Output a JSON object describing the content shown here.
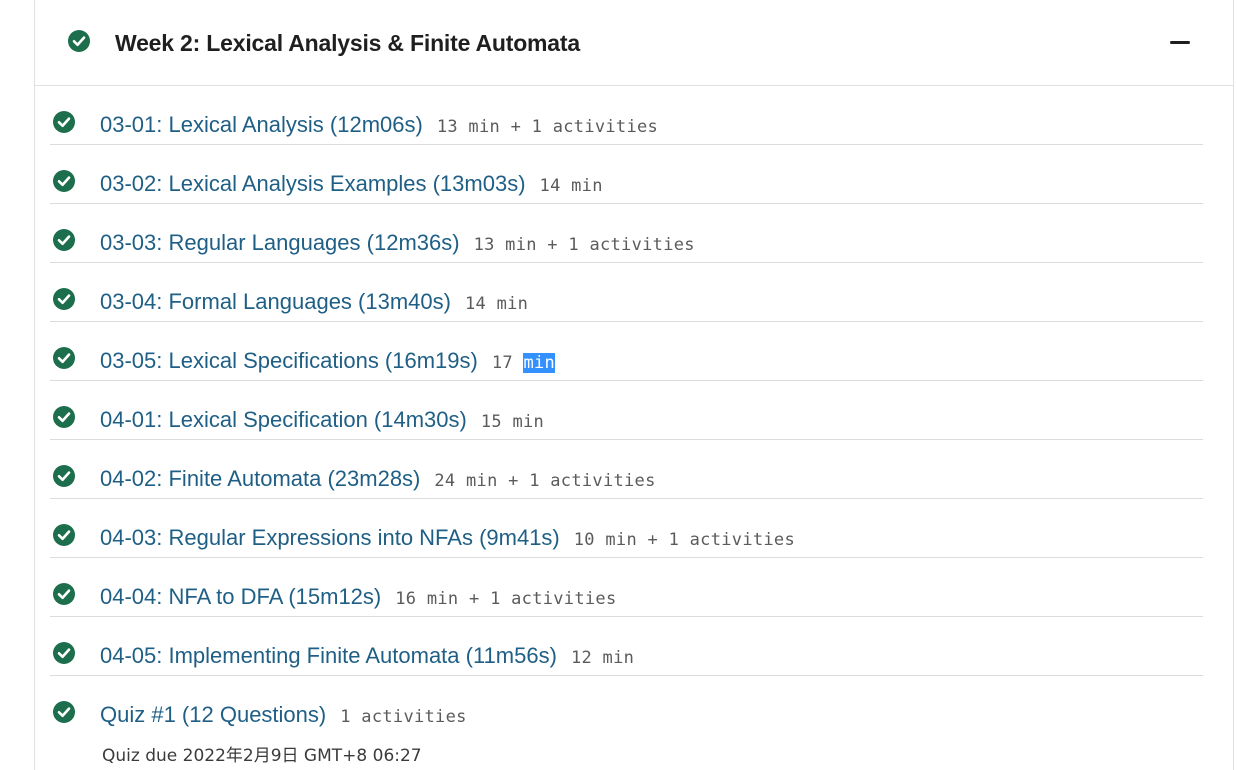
{
  "week": {
    "title": "Week 2: Lexical Analysis & Finite Automata",
    "status_icon": "check-circle-icon",
    "collapse_icon": "minus-icon"
  },
  "colors": {
    "check": "#1d6e4d",
    "link": "#1f5f86",
    "selection": "#3390ff"
  },
  "items": [
    {
      "title": "03-01: Lexical Analysis (12m06s)",
      "meta": "13 min + 1 activities"
    },
    {
      "title": "03-02: Lexical Analysis Examples (13m03s)",
      "meta": "14 min"
    },
    {
      "title": "03-03: Regular Languages (12m36s)",
      "meta": "13 min + 1 activities"
    },
    {
      "title": "03-04: Formal Languages (13m40s)",
      "meta": "14 min"
    },
    {
      "title": "03-05: Lexical Specifications (16m19s)",
      "meta_prefix": "17 ",
      "meta_selected": "min"
    },
    {
      "title": "04-01: Lexical Specification (14m30s)",
      "meta": "15 min"
    },
    {
      "title": "04-02: Finite Automata (23m28s)",
      "meta": "24 min + 1 activities"
    },
    {
      "title": "04-03: Regular Expressions into NFAs (9m41s)",
      "meta": "10 min + 1 activities"
    },
    {
      "title": "04-04: NFA to DFA (15m12s)",
      "meta": "16 min + 1 activities"
    },
    {
      "title": "04-05: Implementing Finite Automata (11m56s)",
      "meta": "12 min"
    },
    {
      "title": "Quiz #1 (12 Questions)",
      "meta": "1 activities",
      "due": "Quiz due 2022年2月9日 GMT+8 06:27"
    }
  ]
}
